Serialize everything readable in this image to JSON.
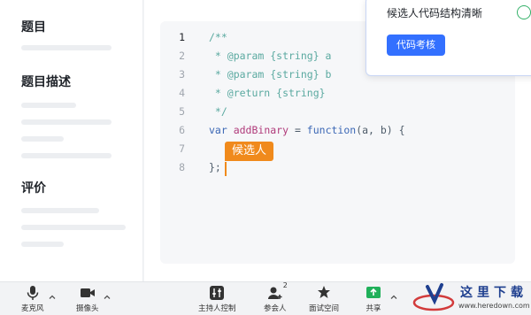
{
  "sidebar": {
    "sections": [
      {
        "title": "题目"
      },
      {
        "title": "题目描述"
      },
      {
        "title": "评价"
      }
    ]
  },
  "editor": {
    "lines": [
      {
        "num": "1",
        "active": true,
        "tokens": [
          {
            "t": "/**",
            "c": "comment"
          }
        ]
      },
      {
        "num": "2",
        "active": false,
        "tokens": [
          {
            "t": " * @param {string} a",
            "c": "comment"
          }
        ]
      },
      {
        "num": "3",
        "active": false,
        "tokens": [
          {
            "t": " * @param {string} b",
            "c": "comment"
          }
        ]
      },
      {
        "num": "4",
        "active": false,
        "tokens": [
          {
            "t": " * @return {string}",
            "c": "comment"
          }
        ]
      },
      {
        "num": "5",
        "active": false,
        "tokens": [
          {
            "t": " */",
            "c": "comment"
          }
        ]
      },
      {
        "num": "6",
        "active": false,
        "tokens": [
          {
            "t": "var ",
            "c": "kw"
          },
          {
            "t": "addBinary",
            "c": "fn"
          },
          {
            "t": " = ",
            "c": "default"
          },
          {
            "t": "function",
            "c": "kw"
          },
          {
            "t": "(a, b) {",
            "c": "default"
          }
        ]
      },
      {
        "num": "7",
        "active": false,
        "tokens": []
      },
      {
        "num": "8",
        "active": false,
        "tokens": [
          {
            "t": "};",
            "c": "default"
          }
        ]
      }
    ],
    "cursor_label": "候选人"
  },
  "popup": {
    "message": "候选人代码结构清晰",
    "button_label": "代码考核"
  },
  "toolbar": {
    "left": [
      {
        "label": "麦克风",
        "icon": "microphone-icon"
      },
      {
        "label": "摄像头",
        "icon": "camera-icon"
      }
    ],
    "center": [
      {
        "label": "主持人控制",
        "icon": "host-control-icon"
      },
      {
        "label": "参会人",
        "icon": "participants-icon",
        "badge": "2"
      },
      {
        "label": "面试空间",
        "icon": "interview-space-icon"
      },
      {
        "label": "共享",
        "icon": "share-screen-icon"
      }
    ]
  },
  "watermark": {
    "title": "这里下载",
    "url": "www.heredown.com"
  },
  "colors": {
    "accent": "#3370ff",
    "cursor": "#f08a1c",
    "share_green": "#20b05a"
  }
}
